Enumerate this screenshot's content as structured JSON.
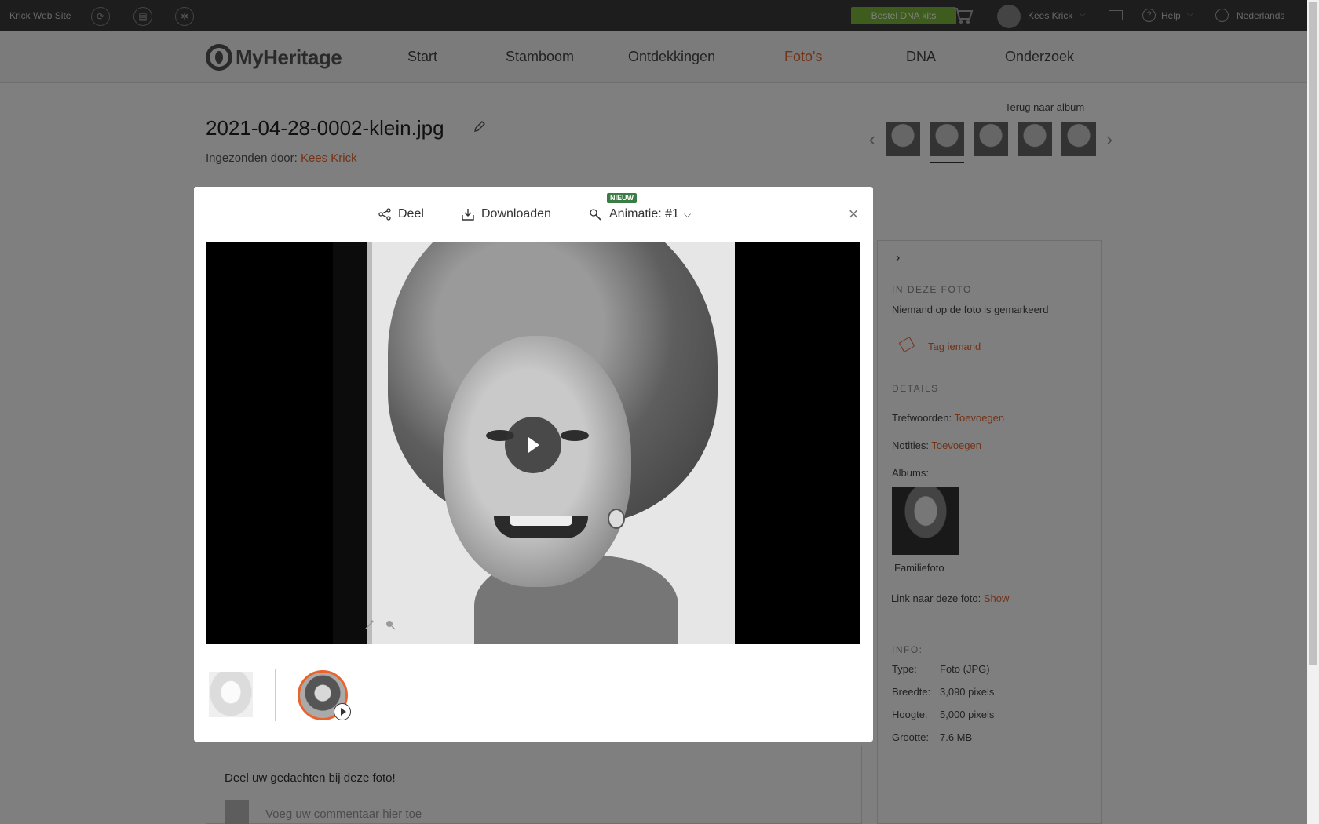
{
  "topbar": {
    "site_name": "Krick Web Site",
    "dna_button": "Bestel DNA kits",
    "user_name": "Kees Krick",
    "help": "Help",
    "language": "Nederlands"
  },
  "nav": {
    "logo": "MyHeritage",
    "items": [
      "Start",
      "Stamboom",
      "Ontdekkingen",
      "Foto's",
      "DNA",
      "Onderzoek"
    ],
    "active_index": 3
  },
  "photo": {
    "title": "2021-04-28-0002-klein.jpg",
    "submitted_label": "Ingezonden door:",
    "submitted_by": "Kees Krick",
    "back_to_album": "Terug naar album"
  },
  "modal": {
    "share": "Deel",
    "download": "Downloaden",
    "animation": "Animatie: #1",
    "badge": "NIEUW"
  },
  "sidebar": {
    "in_photo_heading": "IN DEZE FOTO",
    "nobody_tagged": "Niemand op de foto is gemarkeerd",
    "tag_someone": "Tag iemand",
    "details_heading": "DETAILS",
    "keywords_label": "Trefwoorden:",
    "keywords_action": "Toevoegen",
    "notes_label": "Notities:",
    "notes_action": "Toevoegen",
    "albums_label": "Albums:",
    "album_name": "Familiefoto",
    "link_label": "Link naar deze foto:",
    "link_action": "Show",
    "info_heading": "INFO:",
    "info": [
      {
        "label": "Type:",
        "value": "Foto (JPG)"
      },
      {
        "label": "Breedte:",
        "value": "3,090 pixels"
      },
      {
        "label": "Hoogte:",
        "value": "5,000 pixels"
      },
      {
        "label": "Grootte:",
        "value": "7.6 MB"
      }
    ]
  },
  "comments": {
    "heading": "Deel uw gedachten bij deze foto!",
    "placeholder": "Voeg uw commentaar hier toe"
  },
  "colors": {
    "accent": "#e8642c",
    "dna_green": "#7db93a",
    "badge_green": "#3a7d44",
    "topbar": "#3b3b3b"
  }
}
